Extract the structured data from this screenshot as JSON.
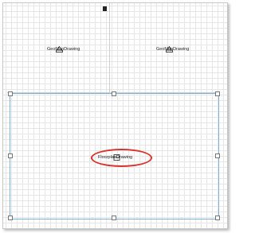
{
  "views": {
    "top_left_label": "GeoMapDrawing",
    "top_right_label": "GeoMapDrawing",
    "bottom_label": "FloorplanDrawing"
  },
  "icons": {
    "view_marker": "viewport-marker-icon",
    "snap": "snap-handle-icon"
  },
  "colors": {
    "selection_border": "#7fb0d8",
    "highlight": "#d9312b",
    "grid": "#e6e6e6"
  }
}
